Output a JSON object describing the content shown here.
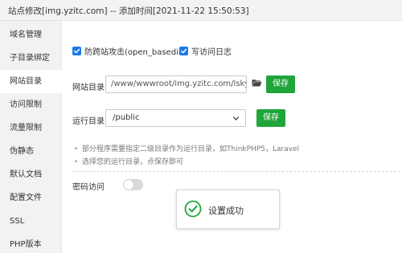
{
  "window": {
    "title": "站点修改[img.yzitc.com] -- 添加时间[2021-11-22 15:50:53]"
  },
  "sidebar": {
    "items": [
      {
        "label": "域名管理"
      },
      {
        "label": "子目录绑定"
      },
      {
        "label": "网站目录",
        "active": true
      },
      {
        "label": "访问限制"
      },
      {
        "label": "流量限制"
      },
      {
        "label": "伪静态"
      },
      {
        "label": "默认文档"
      },
      {
        "label": "配置文件"
      },
      {
        "label": "SSL"
      },
      {
        "label": "PHP版本"
      }
    ]
  },
  "options": {
    "anti_xss": {
      "label": "防跨站攻击(open_basedir)",
      "checked": true
    },
    "access_log": {
      "label": "写访问日志",
      "checked": true
    }
  },
  "site_dir": {
    "label": "网站目录",
    "value": "/www/wwwroot/img.yzitc.com/lsky-pro-",
    "folder_icon": "folder-open-icon",
    "save_label": "保存"
  },
  "run_dir": {
    "label": "运行目录",
    "selected": "/public",
    "save_label": "保存"
  },
  "tips": [
    "部分程序需要指定二级目录作为运行目录，如ThinkPHP5，Laravel",
    "选择您的运行目录，点保存即可"
  ],
  "password_access": {
    "label": "密码访问",
    "enabled": false
  },
  "toast": {
    "message": "设置成功",
    "icon": "check-circle-icon"
  },
  "colors": {
    "accent_blue": "#1e7be6",
    "save_green": "#20a53a",
    "success_green": "#20a53a",
    "sidebar_bg": "#f2f2f2"
  }
}
